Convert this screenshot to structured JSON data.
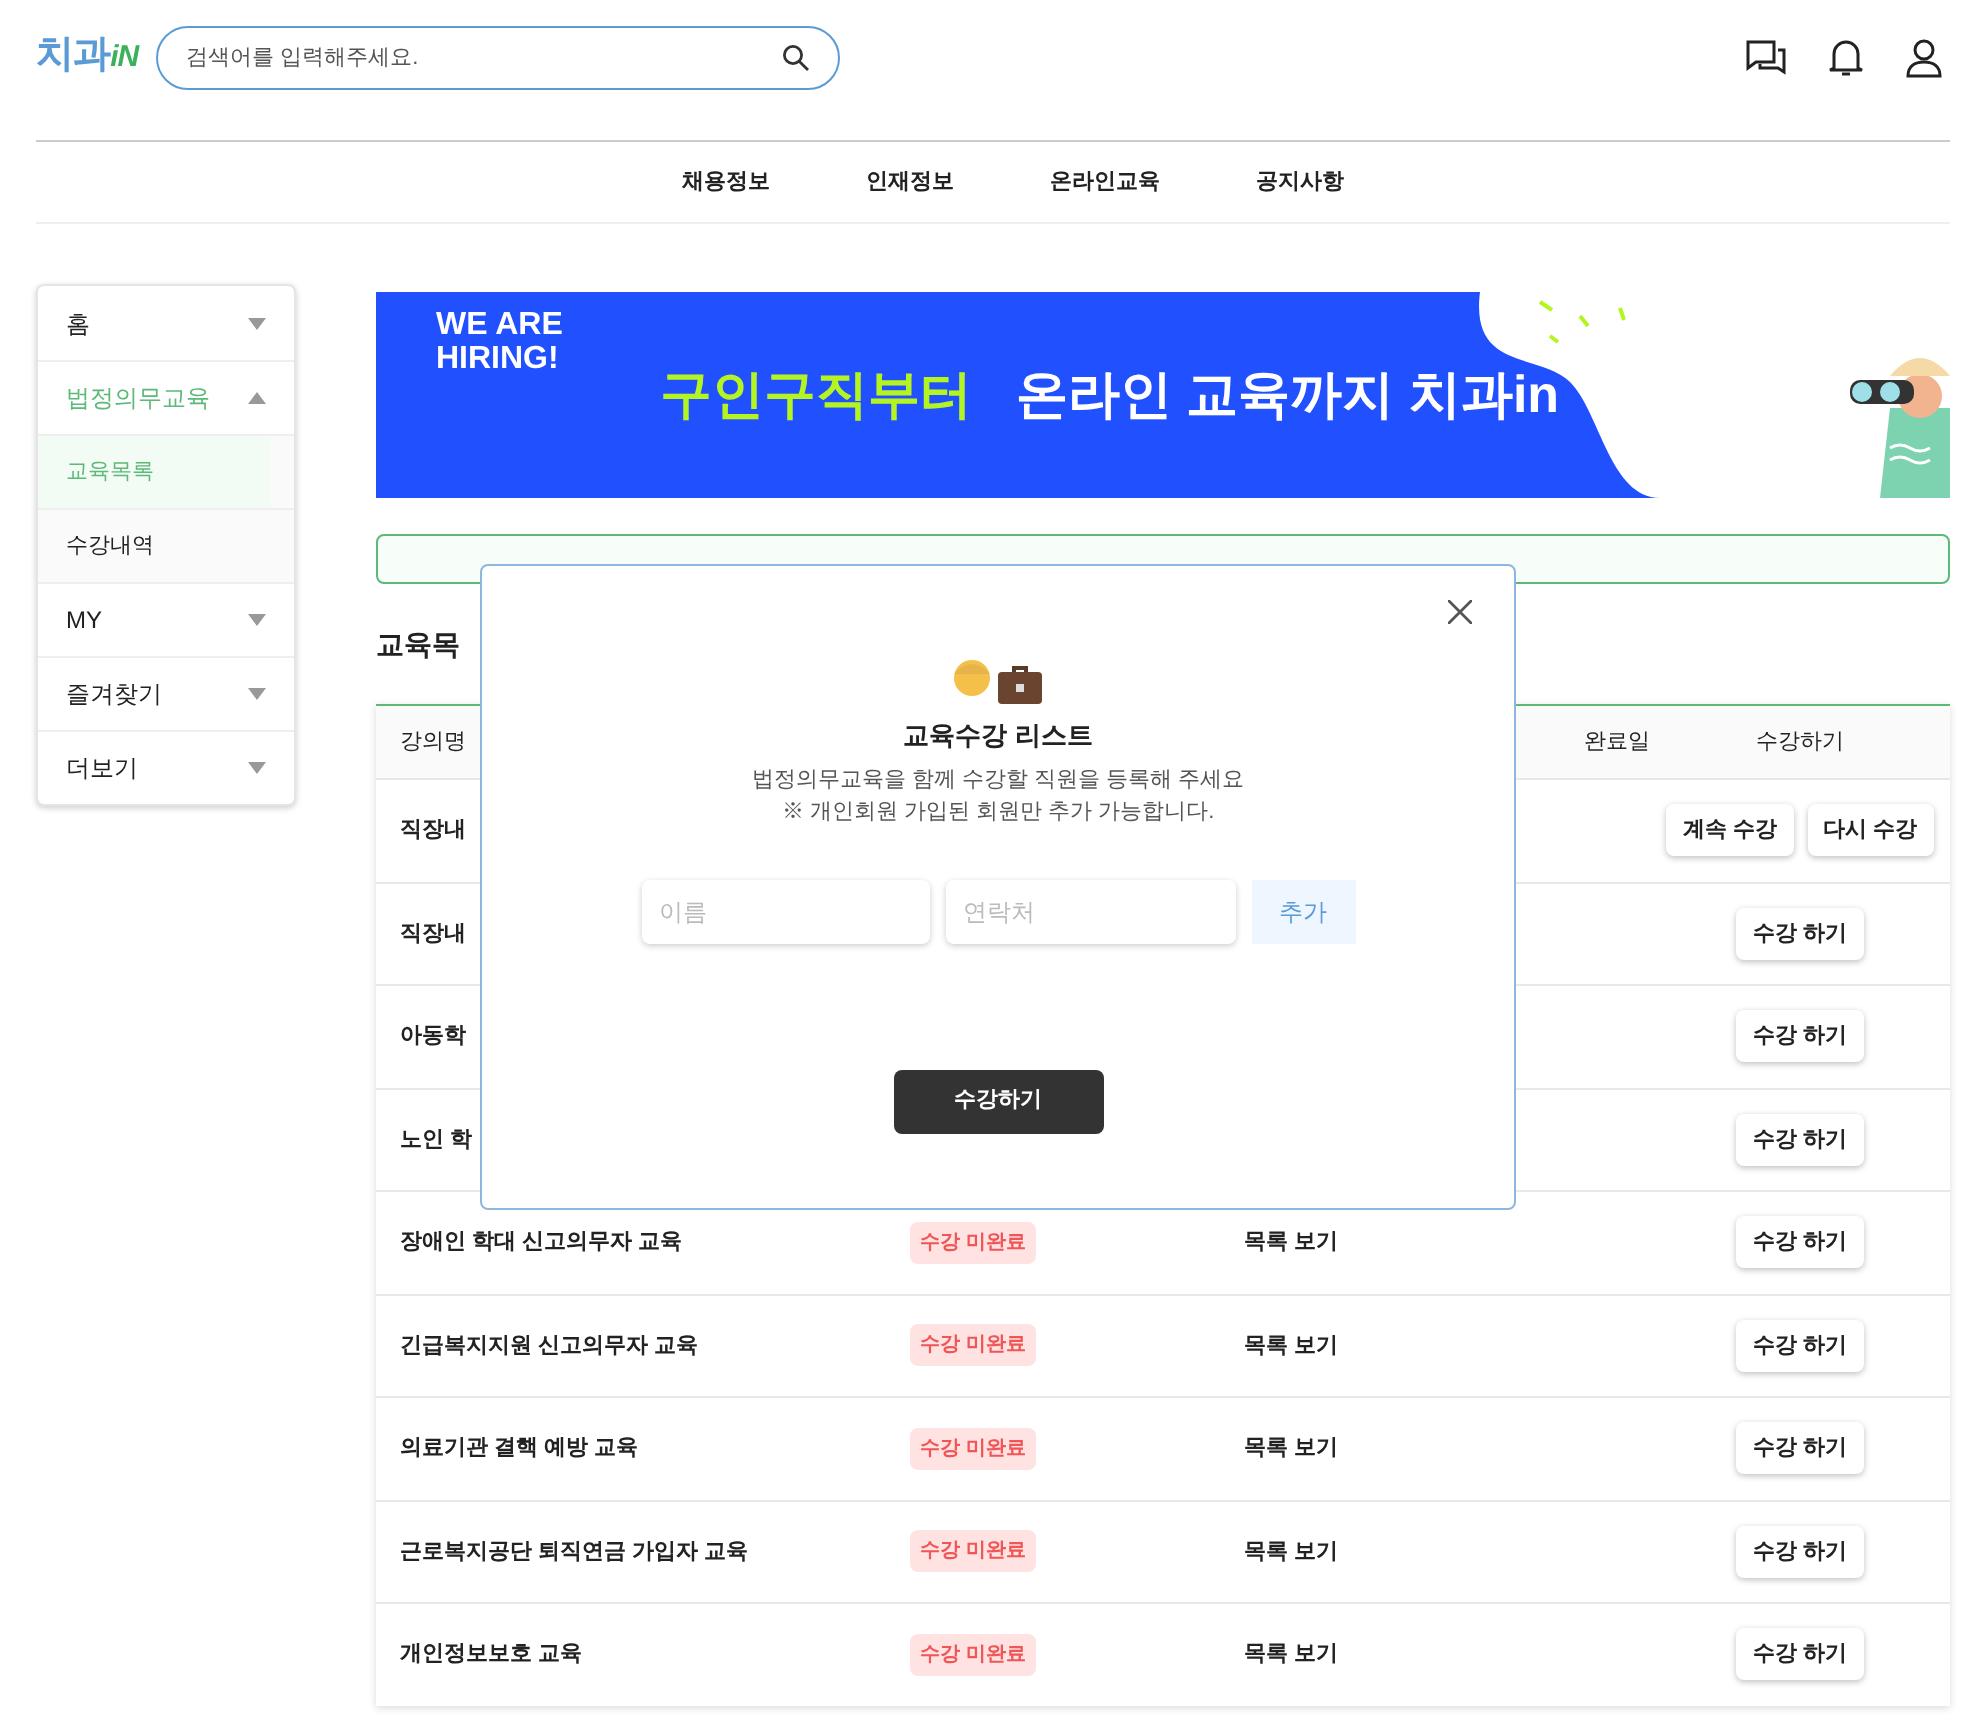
{
  "header": {
    "logo": {
      "text": "치과",
      "suffix": "iN"
    },
    "search": {
      "placeholder": "검색어를 입력해주세요."
    }
  },
  "nav": [
    "채용정보",
    "인재정보",
    "온라인교육",
    "공지사항"
  ],
  "sidebar": {
    "items": [
      {
        "label": "홈",
        "expanded": false
      },
      {
        "label": "법정의무교육",
        "expanded": true,
        "children": [
          {
            "label": "교육목록",
            "selected": true
          },
          {
            "label": "수강내역",
            "selected": false
          }
        ]
      },
      {
        "label": "MY",
        "expanded": false
      },
      {
        "label": "즐겨찾기",
        "expanded": false
      },
      {
        "label": "더보기",
        "expanded": false
      }
    ]
  },
  "banner": {
    "tagline": "WE ARE\nHIRING!",
    "highlight": "구인구직부터",
    "text": "온라인 교육까지 치과in"
  },
  "section_title": "교육목",
  "table": {
    "columns": [
      "강의명",
      "",
      "",
      "완료일",
      "수강하기"
    ],
    "rows": [
      {
        "name": "직장내",
        "actions": [
          "계속 수강",
          "다시 수강"
        ]
      },
      {
        "name": "직장내",
        "actions": [
          "수강 하기"
        ]
      },
      {
        "name": "아동학",
        "actions": [
          "수강 하기"
        ]
      },
      {
        "name": "노인 학",
        "actions": [
          "수강 하기"
        ]
      },
      {
        "name": "장애인 학대 신고의무자 교육",
        "status": "수강 미완료",
        "list": "목록 보기",
        "actions": [
          "수강 하기"
        ]
      },
      {
        "name": "긴급복지지원 신고의무자 교육",
        "status": "수강 미완료",
        "list": "목록 보기",
        "actions": [
          "수강 하기"
        ]
      },
      {
        "name": "의료기관 결핵 예방 교육",
        "status": "수강 미완료",
        "list": "목록 보기",
        "actions": [
          "수강 하기"
        ]
      },
      {
        "name": "근로복지공단 퇴직연금 가입자 교육",
        "status": "수강 미완료",
        "list": "목록 보기",
        "actions": [
          "수강 하기"
        ]
      },
      {
        "name": "개인정보보호 교육",
        "status": "수강 미완료",
        "list": "목록 보기",
        "actions": [
          "수강 하기"
        ]
      }
    ]
  },
  "modal": {
    "title": "교육수강 리스트",
    "description": "법정의무교육을 함께 수강할 직원을 등록해 주세요",
    "note": "※ 개인회원 가입된 회원만 추가 가능합니다.",
    "name_field": {
      "placeholder": "이름"
    },
    "contact_field": {
      "placeholder": "연락처"
    },
    "add_button": "추가",
    "submit_button": "수강하기"
  }
}
